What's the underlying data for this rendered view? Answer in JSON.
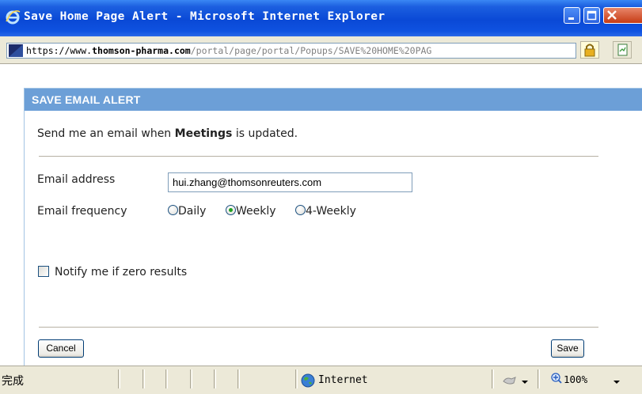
{
  "window": {
    "title": "Save Home Page Alert - Microsoft Internet Explorer"
  },
  "address_bar": {
    "url_scheme": "https://www.",
    "url_host": "thomson-pharma.com",
    "url_path": "/portal/page/portal/Popups/SAVE%20HOME%20PAG"
  },
  "dialog": {
    "title": "SAVE EMAIL ALERT",
    "intro_prefix": "Send me an email when ",
    "intro_subject": "Meetings",
    "intro_suffix": " is updated.",
    "email_label": "Email address",
    "email_value": "hui.zhang@thomsonreuters.com",
    "frequency_label": "Email frequency",
    "frequency_options": [
      {
        "label": "Daily",
        "selected": false
      },
      {
        "label": "Weekly",
        "selected": true
      },
      {
        "label": "4-Weekly",
        "selected": false
      }
    ],
    "notify_label": "Notify me if zero results",
    "notify_checked": false,
    "cancel_label": "Cancel",
    "save_label": "Save"
  },
  "status_bar": {
    "status_text": "完成",
    "zone_text": "Internet",
    "zoom_text": "100%"
  },
  "colors": {
    "titlebar": "#0a49d6",
    "dialog_header": "#6c9fd7",
    "chrome": "#ece9d8",
    "radio_selected": "#21a121"
  }
}
